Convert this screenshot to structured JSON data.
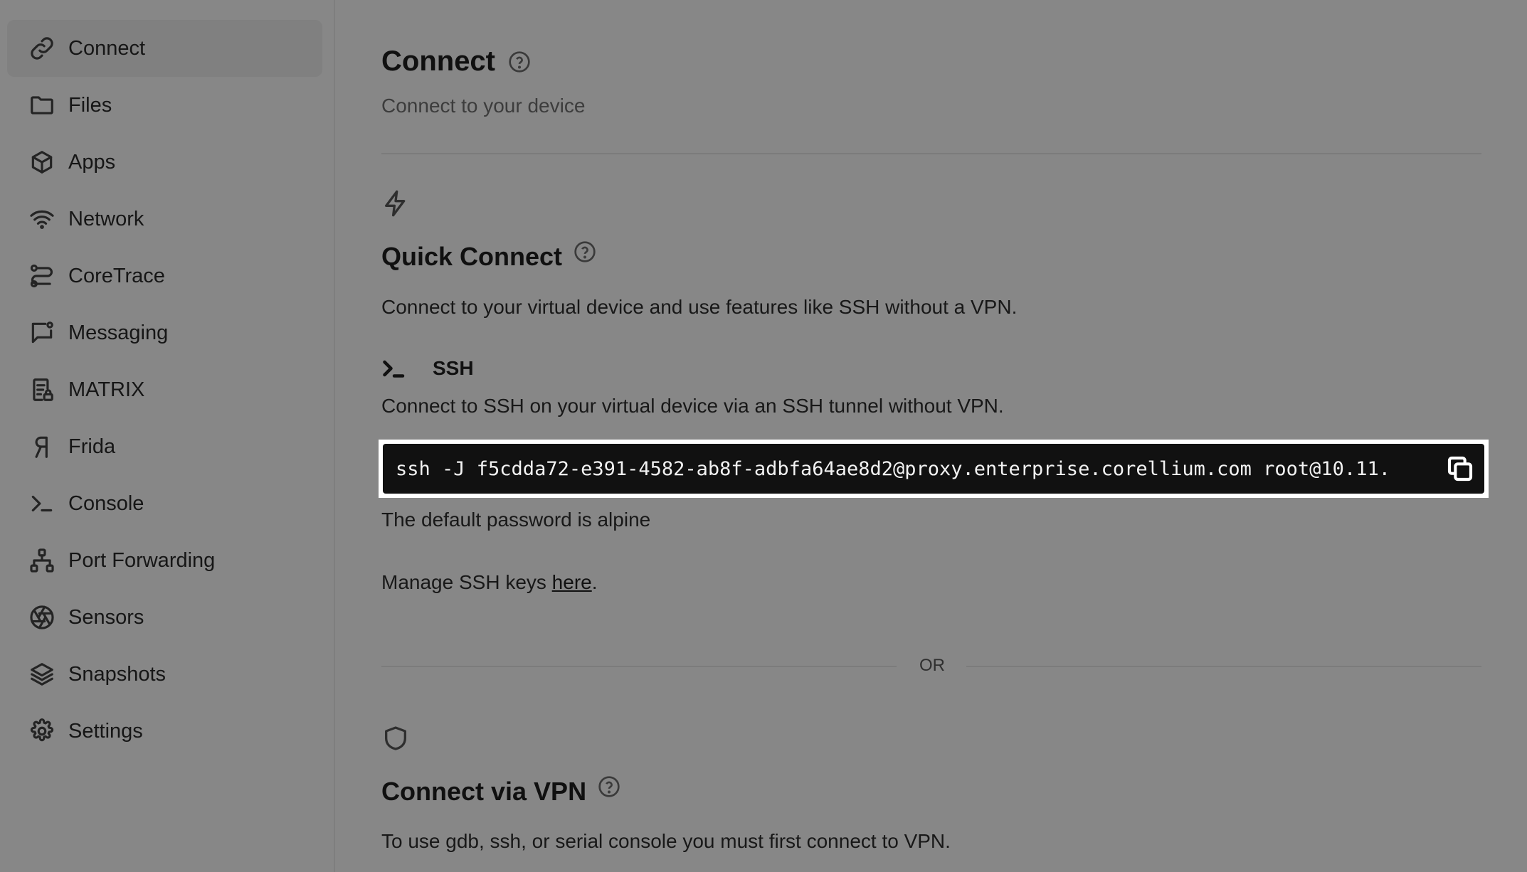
{
  "sidebar": {
    "items": [
      {
        "label": "Connect",
        "icon": "link-icon"
      },
      {
        "label": "Files",
        "icon": "folder-icon"
      },
      {
        "label": "Apps",
        "icon": "cube-icon"
      },
      {
        "label": "Network",
        "icon": "wifi-icon"
      },
      {
        "label": "CoreTrace",
        "icon": "trace-icon"
      },
      {
        "label": "Messaging",
        "icon": "message-icon"
      },
      {
        "label": "MATRIX",
        "icon": "report-lock-icon"
      },
      {
        "label": "Frida",
        "icon": "frida-icon"
      },
      {
        "label": "Console",
        "icon": "terminal-icon"
      },
      {
        "label": "Port Forwarding",
        "icon": "network-tree-icon"
      },
      {
        "label": "Sensors",
        "icon": "aperture-icon"
      },
      {
        "label": "Snapshots",
        "icon": "layers-icon"
      },
      {
        "label": "Settings",
        "icon": "gear-icon"
      }
    ],
    "active": "Connect"
  },
  "header": {
    "title": "Connect",
    "subtitle": "Connect to your device"
  },
  "quick_connect": {
    "title": "Quick Connect",
    "description": "Connect to your virtual device and use features like SSH without a VPN.",
    "ssh_label": "SSH",
    "ssh_description": "Connect to SSH on your virtual device via an SSH tunnel without VPN.",
    "command": "ssh -J f5cdda72-e391-4582-ab8f-adbfa64ae8d2@proxy.enterprise.corellium.com root@10.11.",
    "password_note": "The default password is alpine",
    "manage_keys_prefix": "Manage SSH keys ",
    "manage_keys_link": "here",
    "manage_keys_suffix": "."
  },
  "separator_label": "OR",
  "vpn": {
    "title": "Connect via VPN",
    "description": "To use gdb, ssh, or serial console you must first connect to VPN."
  }
}
